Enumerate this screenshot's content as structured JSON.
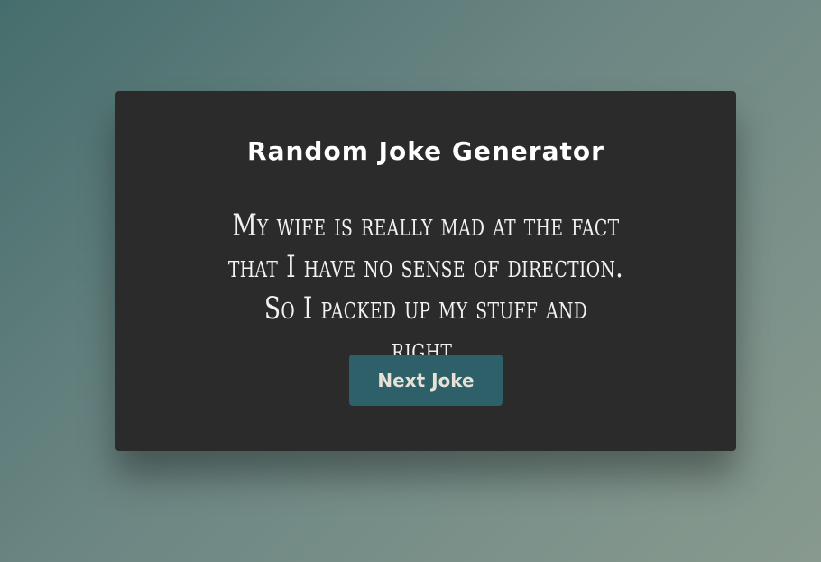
{
  "app": {
    "title": "Random Joke Generator"
  },
  "joke": {
    "text": "My wife is really mad at the fact that I have no sense of direction. So I packed up my stuff and right."
  },
  "controls": {
    "next_label": "Next Joke"
  },
  "colors": {
    "card_background": "#2b2b2b",
    "button_background": "#2d6068",
    "button_text": "#e6e2d6",
    "title_text": "#ffffff"
  }
}
